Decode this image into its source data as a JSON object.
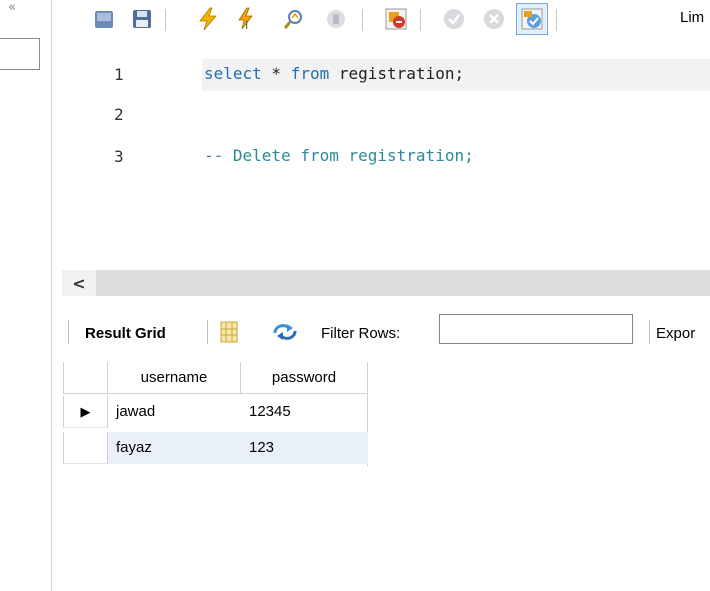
{
  "window": {
    "left_glyph": "«"
  },
  "toolbar": {
    "limit_label": "Lim"
  },
  "editor": {
    "lines": [
      {
        "number": "1",
        "keyword1": "select",
        "rest": " * ",
        "keyword2": "from",
        "tail": " registration;"
      },
      {
        "number": "2"
      },
      {
        "number": "3",
        "comment": "-- Delete from registration;"
      }
    ]
  },
  "scrollbar": {
    "left_arrow": "<"
  },
  "result": {
    "grid_label": "Result Grid",
    "filter_label": "Filter Rows:",
    "filter_value": "",
    "export_label": "Expor",
    "columns": [
      "username",
      "password"
    ],
    "rows": [
      {
        "marker": "▶",
        "username": "jawad",
        "password": "12345"
      },
      {
        "marker": "",
        "username": "fayaz",
        "password": "123"
      }
    ]
  },
  "colors": {
    "keyword": "#1d6fb8",
    "comment": "#2a8a9a",
    "selected_row": "#e9f0fa"
  }
}
